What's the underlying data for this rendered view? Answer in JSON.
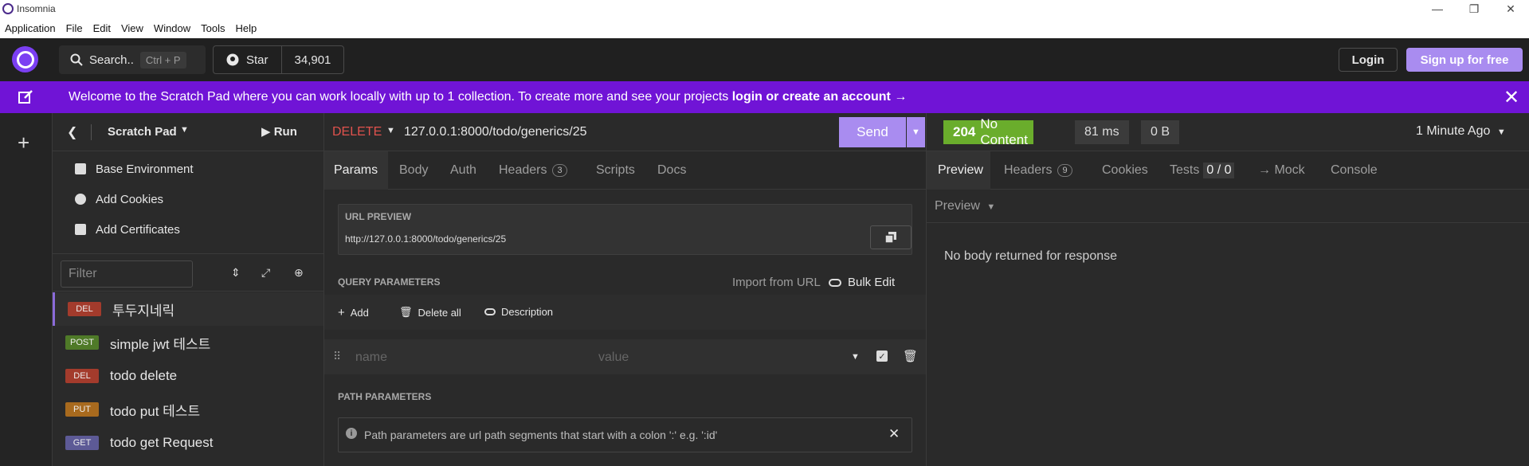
{
  "os": {
    "title": "Insomnia",
    "menu": [
      "Application",
      "File",
      "Edit",
      "View",
      "Window",
      "Tools",
      "Help"
    ]
  },
  "header": {
    "search_label": "Search..",
    "search_shortcut": "Ctrl + P",
    "star_label": "Star",
    "star_count": "34,901",
    "login_label": "Login",
    "signup_label": "Sign up for free"
  },
  "banner": {
    "message": "Welcome to the Scratch Pad where you can work locally with up to 1 collection. To create more and see your projects ",
    "link": "login or create an account →"
  },
  "sidebar": {
    "title": "Scratch Pad",
    "run_label": "Run",
    "items": [
      "Base Environment",
      "Add Cookies",
      "Add Certificates"
    ],
    "filter_placeholder": "Filter",
    "requests": [
      {
        "method": "DEL",
        "name": "투두지네릭",
        "color": "#a33b2c"
      },
      {
        "method": "POST",
        "name": "simple jwt 테스트",
        "color": "#4f7a28"
      },
      {
        "method": "DEL",
        "name": "todo delete",
        "color": "#a33b2c"
      },
      {
        "method": "PUT",
        "name": "todo put 테스트",
        "color": "#a86a1e"
      },
      {
        "method": "GET",
        "name": "todo get Request",
        "color": "#5d5a96"
      }
    ]
  },
  "request": {
    "method": "DELETE",
    "url": "127.0.0.1:8000/todo/generics/25",
    "send_label": "Send",
    "tabs": [
      {
        "label": "Params"
      },
      {
        "label": "Body"
      },
      {
        "label": "Auth"
      },
      {
        "label": "Headers",
        "count": "3"
      },
      {
        "label": "Scripts"
      },
      {
        "label": "Docs"
      }
    ],
    "url_preview_label": "URL PREVIEW",
    "url_preview_value": "http://127.0.0.1:8000/todo/generics/25",
    "query_label": "QUERY PARAMETERS",
    "import_label": "Import from URL",
    "bulk_label": "Bulk Edit",
    "add_label": "Add",
    "delete_all_label": "Delete all",
    "description_label": "Description",
    "name_placeholder": "name",
    "value_placeholder": "value",
    "path_label": "PATH PARAMETERS",
    "path_info": "Path parameters are url path segments that start with a colon ':' e.g. ':id'"
  },
  "response": {
    "status_code": "204",
    "status_text": "No Content",
    "time": "81 ms",
    "size": "0 B",
    "ago": "1 Minute Ago",
    "tabs": [
      {
        "label": "Preview"
      },
      {
        "label": "Headers",
        "count": "9"
      },
      {
        "label": "Cookies"
      },
      {
        "label": "Tests",
        "count": "0 / 0"
      },
      {
        "label": "→ Mock"
      },
      {
        "label": "Console"
      }
    ],
    "preview_label": "Preview",
    "empty_message": "No body returned for response"
  }
}
